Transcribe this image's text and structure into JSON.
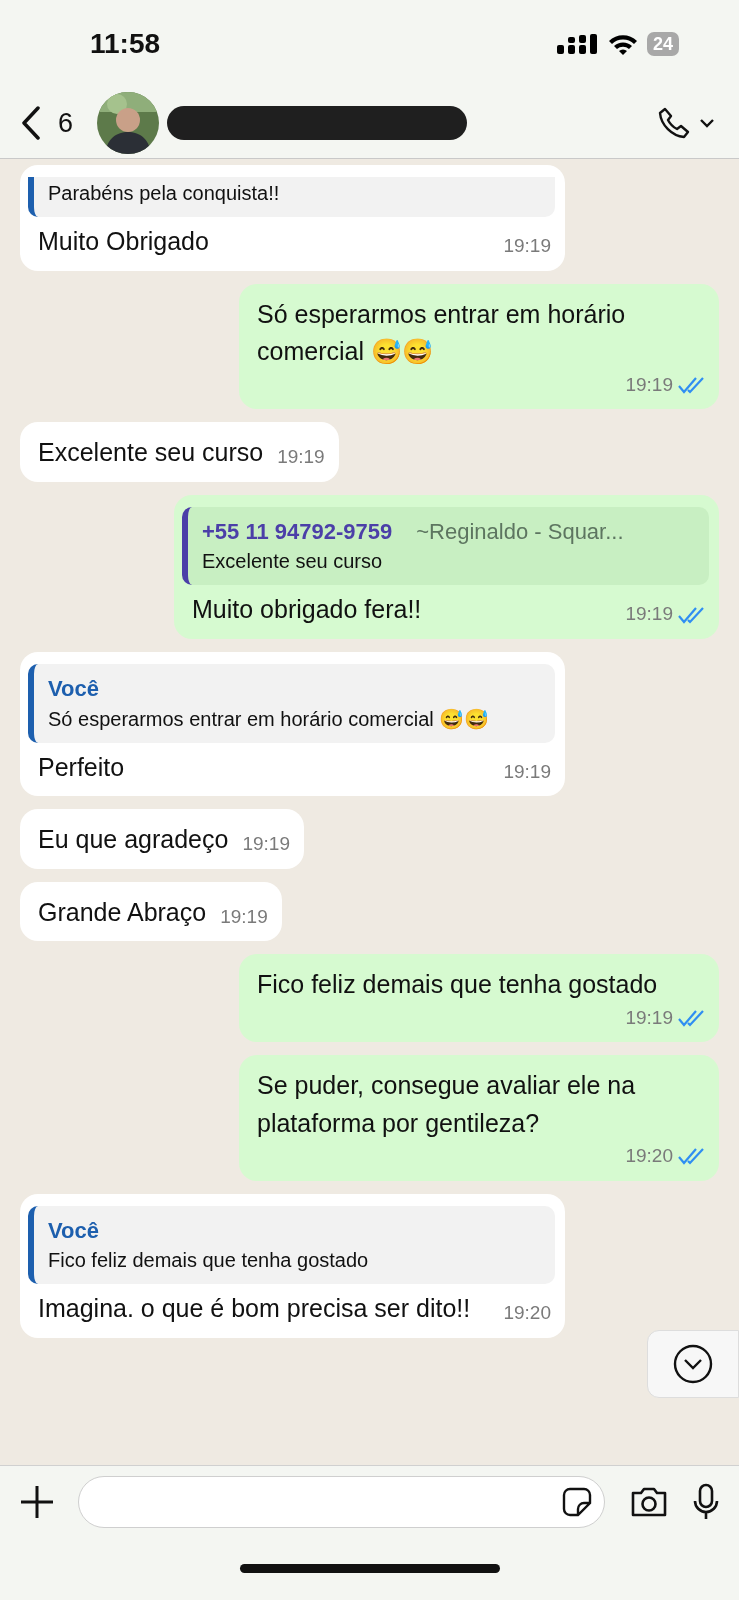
{
  "status_bar": {
    "time": "11:58",
    "battery": "24"
  },
  "header": {
    "back_count": "6"
  },
  "messages": [
    {
      "kind": "in",
      "quote": {
        "text": "Parabéns pela conquista!!",
        "color": "#1d5fae"
      },
      "text": "Muito Obrigado",
      "time": "19:19"
    },
    {
      "kind": "out",
      "text": "Só esperarmos entrar em horário comercial 😅😅",
      "time": "19:19",
      "read": true
    },
    {
      "kind": "in",
      "text": "Excelente seu curso",
      "time": "19:19"
    },
    {
      "kind": "out",
      "quote": {
        "author": "+55 11 94792-9759",
        "author_note": "~Reginaldo - Squar...",
        "text": "Excelente seu curso",
        "color": "#4b3fa8"
      },
      "text": "Muito obrigado fera!!",
      "time": "19:19",
      "read": true
    },
    {
      "kind": "in",
      "quote": {
        "author": "Você",
        "text": "Só esperarmos entrar em horário comercial 😅😅",
        "color": "#1d5fae"
      },
      "text": "Perfeito",
      "time": "19:19"
    },
    {
      "kind": "in",
      "text": "Eu que agradeço",
      "time": "19:19"
    },
    {
      "kind": "in",
      "text": "Grande Abraço",
      "time": "19:19"
    },
    {
      "kind": "out",
      "text": "Fico feliz demais que tenha gostado",
      "time": "19:19",
      "read": true
    },
    {
      "kind": "out",
      "text": "Se puder, consegue avaliar ele na plataforma por gentileza?",
      "time": "19:20",
      "read": true
    },
    {
      "kind": "in",
      "quote": {
        "author": "Você",
        "text": "Fico feliz demais que tenha gostado",
        "color": "#1d5fae"
      },
      "text": "Imagina. o que é bom precisa ser dito!!",
      "time": "19:20"
    }
  ]
}
